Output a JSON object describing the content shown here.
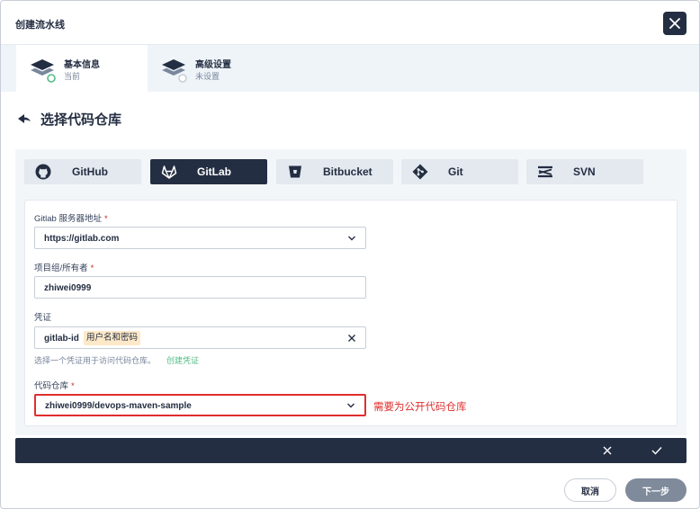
{
  "dialog": {
    "title": "创建流水线"
  },
  "steps": [
    {
      "title": "基本信息",
      "status": "当前"
    },
    {
      "title": "高级设置",
      "status": "未设置"
    }
  ],
  "page": {
    "title": "选择代码仓库"
  },
  "tabs": [
    {
      "label": "GitHub",
      "icon": "github-icon"
    },
    {
      "label": "GitLab",
      "icon": "gitlab-icon",
      "selected": true
    },
    {
      "label": "Bitbucket",
      "icon": "bitbucket-icon"
    },
    {
      "label": "Git",
      "icon": "git-icon"
    },
    {
      "label": "SVN",
      "icon": "svn-icon"
    }
  ],
  "form": {
    "server": {
      "label": "Gitlab 服务器地址",
      "required": "*",
      "value": "https://gitlab.com"
    },
    "owner": {
      "label": "项目组/所有者",
      "required": "*",
      "value": "zhiwei0999"
    },
    "credential": {
      "label": "凭证",
      "value": "gitlab-id",
      "tag": "用户名和密码",
      "help": "选择一个凭证用于访问代码仓库。",
      "create_link": "创建凭证"
    },
    "repo": {
      "label": "代码仓库",
      "required": "*",
      "value": "zhiwei0999/devops-maven-sample"
    },
    "annotation": "需要为公开代码仓库"
  },
  "footer": {
    "cancel_label": "取消",
    "next_label": "下一步"
  },
  "colors": {
    "dark": "#242e42",
    "panel": "#f3f6f9",
    "step_bar": "#eff4f9",
    "accent_green": "#55bc8a",
    "highlight_red": "#e02e2e",
    "tag_bg": "#fde8c8"
  }
}
